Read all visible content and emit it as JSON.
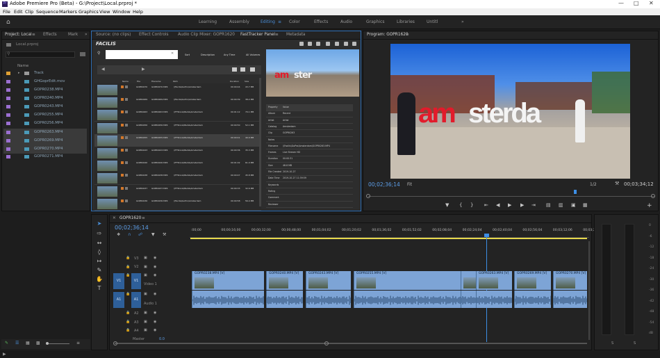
{
  "app_title": "Adobe Premiere Pro (Beta) - G:\\Project\\Local.prproj *",
  "menu": [
    "File",
    "Edit",
    "Clip",
    "Sequence",
    "Markers",
    "Graphics",
    "View",
    "Window",
    "Help"
  ],
  "workspaces": [
    "Learning",
    "Assembly",
    "Editing",
    "Color",
    "Effects",
    "Audio",
    "Graphics",
    "Libraries",
    "Untitl"
  ],
  "active_workspace": "Editing",
  "project_panel": {
    "tabs": [
      "Project: Local",
      "Effects",
      "Mark"
    ],
    "project_file": "Local.prproj",
    "column_name": "Name",
    "items": [
      {
        "name": "Track",
        "color": "#e0a033",
        "type": "folder"
      },
      {
        "name": "GHGoprEdit.mov",
        "color": "#9b6fd1",
        "type": "clip"
      },
      {
        "name": "GOPR0238.MP4",
        "color": "#9b6fd1",
        "type": "clip"
      },
      {
        "name": "GOPR0240.MP4",
        "color": "#9b6fd1",
        "type": "clip"
      },
      {
        "name": "GOPR0243.MP4",
        "color": "#9b6fd1",
        "type": "clip"
      },
      {
        "name": "GOPR0255.MP4",
        "color": "#9b6fd1",
        "type": "clip"
      },
      {
        "name": "GOPR0256.MP4",
        "color": "#9b6fd1",
        "type": "clip"
      },
      {
        "name": "GOPR0263.MP4",
        "color": "#9b6fd1",
        "type": "clip"
      },
      {
        "name": "GOPR0269.MP4",
        "color": "#9b6fd1",
        "type": "clip"
      },
      {
        "name": "GOPR0270.MP4",
        "color": "#9b6fd1",
        "type": "clip"
      },
      {
        "name": "GOPR0271.MP4",
        "color": "#9b6fd1",
        "type": "clip"
      }
    ]
  },
  "source_panel": {
    "tabs": [
      "Source: (no clips)",
      "Effect Controls",
      "Audio Clip Mixer: GOPR1620",
      "FastTracker Panel",
      "Metadata"
    ]
  },
  "fasttracker": {
    "logo": "FACILIS",
    "toolbar": [
      "Sort",
      "Description",
      "Any Time",
      "All Volumes"
    ],
    "columns": [
      "Name",
      "File",
      "Filename",
      "Path",
      "Duration",
      "Size"
    ],
    "rows": [
      [
        "GOPR0270",
        "GOPR0270.MP4",
        "\\\\Facilis\\GoPro\\Amsterdam",
        "00:00:44",
        "43.7 MB"
      ],
      [
        "GOPR0269",
        "GOPR0269.MP4",
        "\\\\Facilis\\GoPro\\Amsterdam",
        "00:00:39",
        "38.2 MB"
      ],
      [
        "GOPR0263",
        "GOPR0263.MP4",
        "\\\\FTStore\\Media\\Amsterdam",
        "00:01:12",
        "70.1 MB"
      ],
      [
        "GOPR0256",
        "GOPR0256.MP4",
        "\\\\FTStore\\Media\\Amsterdam",
        "00:00:50",
        "52.1 MB"
      ],
      [
        "GOPR0255",
        "GOPR0255.MP4",
        "\\\\FTStore\\Media\\Amsterdam",
        "00:00:41",
        "40.9 MB"
      ],
      [
        "GOPR0243",
        "GOPR0243.MP4",
        "\\\\FTStore\\Media\\Amsterdam",
        "00:00:36",
        "35.3 MB"
      ],
      [
        "GOPR0240",
        "GOPR0240.MP4",
        "\\\\FTStore\\Media\\Amsterdam",
        "00:01:02",
        "61.0 MB"
      ],
      [
        "GOPR0238",
        "GOPR0238.MP4",
        "\\\\FTStore\\Media\\Amsterdam",
        "00:00:47",
        "45.8 MB"
      ],
      [
        "GOPR0237",
        "GOPR0237.MP4",
        "\\\\FTStore\\Media\\Amsterdam",
        "00:00:33",
        "32.6 MB"
      ],
      [
        "GOPR0236",
        "GOPR0236.MP4",
        "\\\\Facilis\\GoPro\\Amsterdam",
        "00:00:58",
        "56.4 MB"
      ]
    ],
    "properties": [
      [
        "Property",
        "Value"
      ],
      [
        "Album",
        "Recent"
      ],
      [
        "Artist",
        "Artist"
      ],
      [
        "Catalog",
        "Amsterdam"
      ],
      [
        "Clip",
        "GOPR0263"
      ],
      [
        "Notes",
        ""
      ],
      [
        "Filename",
        "\\\\Facilis\\GoPro\\Amsterdam\\GOPR0263.MP4"
      ],
      [
        "Frames",
        "Live Stream HD"
      ],
      [
        "Duration",
        "00:00:31"
      ],
      [
        "Size",
        "48.8 MB"
      ],
      [
        "File Created",
        "2019-10-27"
      ],
      [
        "Date Time",
        "2019-10-27 11:39:59"
      ],
      [
        "Keywords",
        ""
      ],
      [
        "Rating",
        ""
      ],
      [
        "Comment",
        ""
      ],
      [
        "Reviewer",
        ""
      ]
    ]
  },
  "program": {
    "tab": "Program: GOPR1620",
    "timecode": "00;02;36;14",
    "fit": "Fit",
    "fraction": "1/2",
    "duration": "00;03;34;12",
    "sign_text": "amsterdam"
  },
  "timeline": {
    "tab": "GOPR1620",
    "timecode": "00;02;36;14",
    "ruler": [
      ":00;00",
      "00;00;16;00",
      "00;00;32;00",
      "00;00;48;00",
      "00;01;04;02",
      "00;01;20;02",
      "00;01;36;02",
      "00;01;52;02",
      "00;02;08;04",
      "00;02;24;04",
      "00;02;40;04",
      "00;02;56;04",
      "00;03;12;06",
      "00;03;2"
    ],
    "tracks_video": [
      "V3",
      "V2",
      "V1"
    ],
    "tracks_audio": [
      "A1",
      "A2",
      "A3",
      "A4"
    ],
    "video1_label": "Video 1",
    "audio1_label": "Audio 1",
    "master_label": "Master",
    "master_value": "0.0",
    "clips": [
      {
        "name": "GOPR0238.MP4 [V]",
        "start": 276,
        "end": 380
      },
      {
        "name": "GOPR0240.MP4 [V]",
        "start": 383,
        "end": 436
      },
      {
        "name": "GOPR0243.MP4 [V]",
        "start": 440,
        "end": 505
      },
      {
        "name": "GOPR0255.MP4 [V]",
        "start": 509,
        "end": 663
      },
      {
        "name": "",
        "start": 663,
        "end": 685
      },
      {
        "name": "GOPR0263.MP4 [V]",
        "start": 685,
        "end": 737
      },
      {
        "name": "GOPR0269.MP4 [V]",
        "start": 740,
        "end": 793
      },
      {
        "name": "GOPR0270.MP4 [V]",
        "start": 796,
        "end": 845
      }
    ]
  },
  "audio_meter": {
    "labels": [
      "0",
      "-6",
      "-12",
      "-18",
      "-24",
      "-30",
      "-36",
      "-42",
      "-48",
      "-54",
      "dB"
    ],
    "s_labels": [
      "S",
      "S"
    ]
  }
}
